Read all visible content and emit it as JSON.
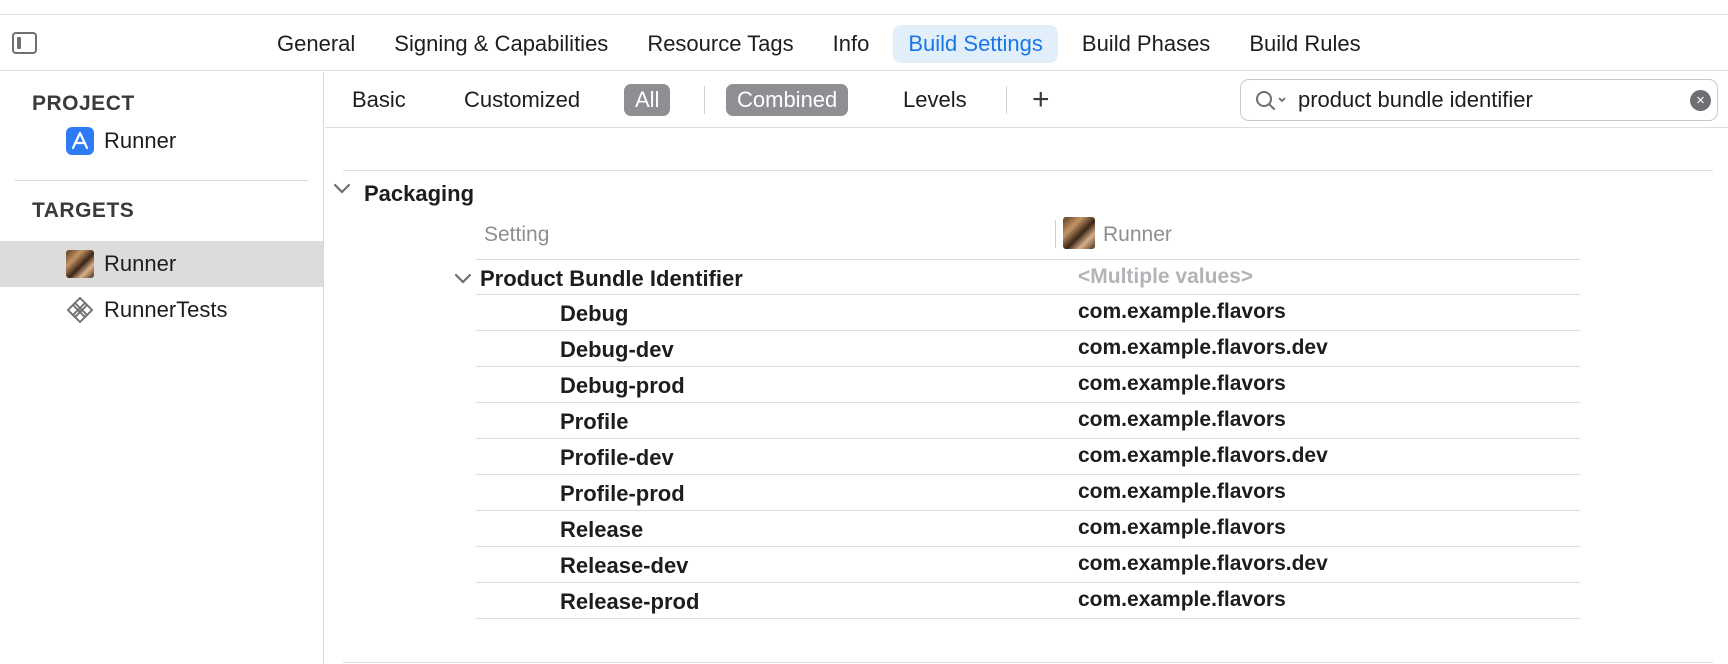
{
  "tabs": [
    "General",
    "Signing & Capabilities",
    "Resource Tags",
    "Info",
    "Build Settings",
    "Build Phases",
    "Build Rules"
  ],
  "active_tab": "Build Settings",
  "sidebar": {
    "project_header": "PROJECT",
    "project_item": "Runner",
    "targets_header": "TARGETS",
    "targets": [
      "Runner",
      "RunnerTests"
    ],
    "selected_target": "Runner"
  },
  "filters": {
    "basic": "Basic",
    "customized": "Customized",
    "all": "All",
    "combined": "Combined",
    "levels": "Levels",
    "add": "+",
    "search_value": "product bundle identifier"
  },
  "settings": {
    "section": "Packaging",
    "col_setting": "Setting",
    "col_target": "Runner",
    "setting_name": "Product Bundle Identifier",
    "setting_value": "<Multiple values>",
    "rows": [
      {
        "config": "Debug",
        "value": "com.example.flavors"
      },
      {
        "config": "Debug-dev",
        "value": "com.example.flavors.dev"
      },
      {
        "config": "Debug-prod",
        "value": "com.example.flavors"
      },
      {
        "config": "Profile",
        "value": "com.example.flavors"
      },
      {
        "config": "Profile-dev",
        "value": "com.example.flavors.dev"
      },
      {
        "config": "Profile-prod",
        "value": "com.example.flavors"
      },
      {
        "config": "Release",
        "value": "com.example.flavors"
      },
      {
        "config": "Release-dev",
        "value": "com.example.flavors.dev"
      },
      {
        "config": "Release-prod",
        "value": "com.example.flavors"
      }
    ]
  },
  "colors": {
    "accent": "#1877e8",
    "active_tab_bg": "#e3eefb",
    "pill_bg": "#8e8e93",
    "selected_row_bg": "#dcdcdc"
  }
}
